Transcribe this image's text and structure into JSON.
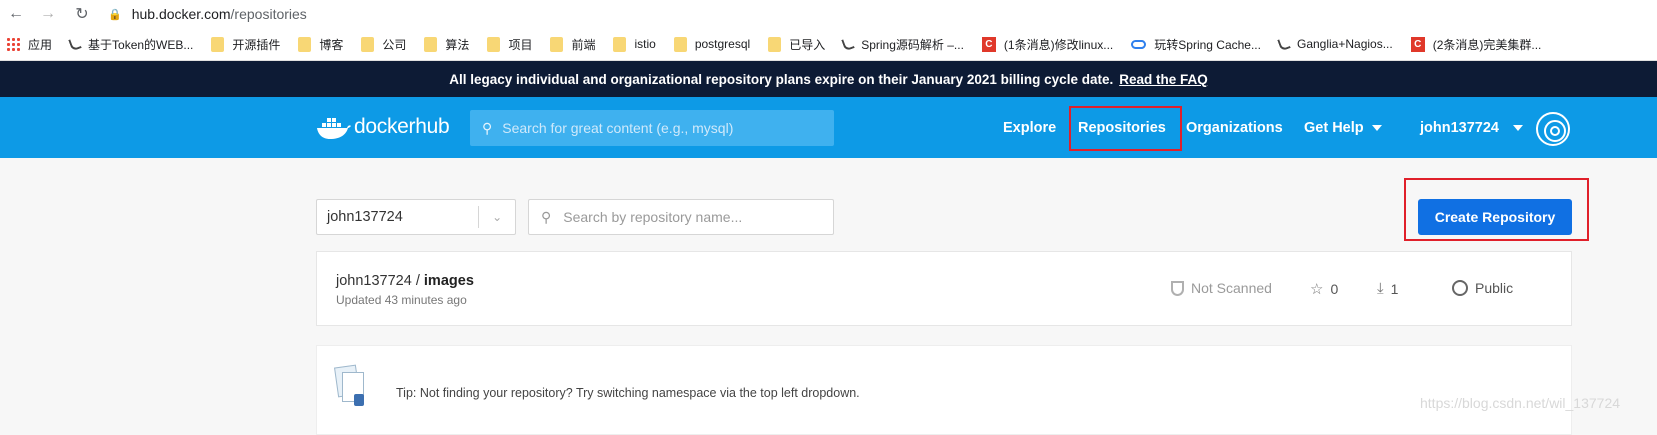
{
  "browser": {
    "url_host": "hub.docker.com",
    "url_path": "/repositories",
    "bookmarks": [
      {
        "label": "应用",
        "icon": "apps-grid-icon"
      },
      {
        "label": "基于Token的WEB...",
        "icon": "leaf-icon"
      },
      {
        "label": "开源插件",
        "icon": "folder-icon"
      },
      {
        "label": "博客",
        "icon": "folder-icon"
      },
      {
        "label": "公司",
        "icon": "folder-icon"
      },
      {
        "label": "算法",
        "icon": "folder-icon"
      },
      {
        "label": "项目",
        "icon": "folder-icon"
      },
      {
        "label": "前端",
        "icon": "folder-icon"
      },
      {
        "label": "istio",
        "icon": "folder-icon"
      },
      {
        "label": "postgresql",
        "icon": "folder-icon"
      },
      {
        "label": "已导入",
        "icon": "folder-icon"
      },
      {
        "label": "Spring源码解析 –...",
        "icon": "leaf-icon"
      },
      {
        "label": "(1条消息)修改linux...",
        "icon": "csdn-icon"
      },
      {
        "label": "玩转Spring Cache...",
        "icon": "cloud-icon"
      },
      {
        "label": "Ganglia+Nagios...",
        "icon": "leaf-icon"
      },
      {
        "label": "(2条消息)完美集群...",
        "icon": "csdn-icon"
      }
    ]
  },
  "banner": {
    "text": "All legacy individual and organizational repository plans expire on their January 2021 billing cycle date.",
    "link": "Read the FAQ"
  },
  "header": {
    "logo_docker": "docker",
    "logo_hub": "hub",
    "search_placeholder": "Search for great content (e.g., mysql)",
    "nav": {
      "explore": "Explore",
      "repositories": "Repositories",
      "organizations": "Organizations",
      "get_help": "Get Help",
      "user": "john137724"
    }
  },
  "controls": {
    "namespace": "john137724",
    "repo_search_placeholder": "Search by repository name...",
    "create_button": "Create Repository"
  },
  "repositories": [
    {
      "namespace": "john137724",
      "separator": " / ",
      "name": "images",
      "updated": "Updated 43 minutes ago",
      "scan_status": "Not Scanned",
      "stars": "0",
      "pulls": "1",
      "visibility": "Public"
    }
  ],
  "tip": {
    "text": "Tip: Not finding your repository? Try switching namespace via the top left dropdown."
  },
  "watermark": "https://blog.csdn.net/wil_137724"
}
